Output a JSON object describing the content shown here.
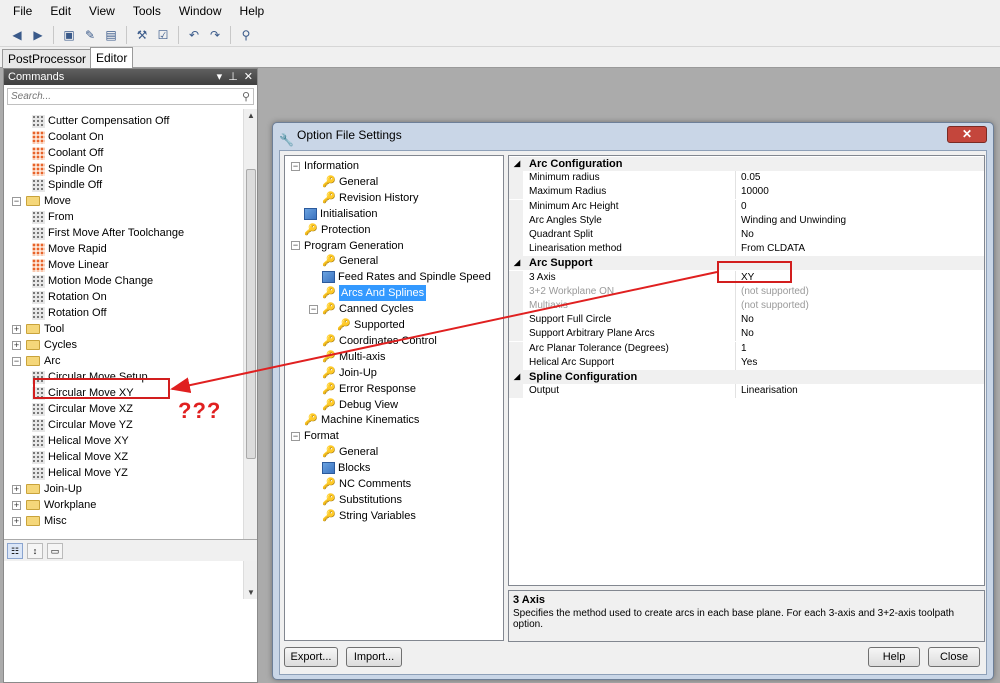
{
  "menu": [
    "File",
    "Edit",
    "View",
    "Tools",
    "Window",
    "Help"
  ],
  "tabs": [
    "PostProcessor",
    "Editor"
  ],
  "commands_panel": {
    "title": "Commands",
    "search_placeholder": "Search...",
    "items": [
      {
        "label": "Cutter Compensation Off",
        "level": 2,
        "icon": "grid"
      },
      {
        "label": "Coolant On",
        "level": 2,
        "icon": "grid-orange"
      },
      {
        "label": "Coolant Off",
        "level": 2,
        "icon": "grid-orange"
      },
      {
        "label": "Spindle On",
        "level": 2,
        "icon": "grid-orange"
      },
      {
        "label": "Spindle Off",
        "level": 2,
        "icon": "grid"
      },
      {
        "label": "Move",
        "level": 1,
        "icon": "folder",
        "expander": "−"
      },
      {
        "label": "From",
        "level": 2,
        "icon": "grid"
      },
      {
        "label": "First Move After Toolchange",
        "level": 2,
        "icon": "grid"
      },
      {
        "label": "Move Rapid",
        "level": 2,
        "icon": "grid-orange"
      },
      {
        "label": "Move Linear",
        "level": 2,
        "icon": "grid-orange"
      },
      {
        "label": "Motion Mode Change",
        "level": 2,
        "icon": "grid"
      },
      {
        "label": "Rotation On",
        "level": 2,
        "icon": "grid"
      },
      {
        "label": "Rotation Off",
        "level": 2,
        "icon": "grid"
      },
      {
        "label": "Tool",
        "level": 1,
        "icon": "folder",
        "expander": "+"
      },
      {
        "label": "Cycles",
        "level": 1,
        "icon": "folder",
        "expander": "+"
      },
      {
        "label": "Arc",
        "level": 1,
        "icon": "folder",
        "expander": "−"
      },
      {
        "label": "Circular Move Setup",
        "level": 2,
        "icon": "grid"
      },
      {
        "label": "Circular Move XY",
        "level": 2,
        "icon": "grid"
      },
      {
        "label": "Circular Move XZ",
        "level": 2,
        "icon": "grid"
      },
      {
        "label": "Circular Move YZ",
        "level": 2,
        "icon": "grid"
      },
      {
        "label": "Helical Move XY",
        "level": 2,
        "icon": "grid"
      },
      {
        "label": "Helical Move XZ",
        "level": 2,
        "icon": "grid"
      },
      {
        "label": "Helical Move YZ",
        "level": 2,
        "icon": "grid"
      },
      {
        "label": "Join-Up",
        "level": 1,
        "icon": "folder",
        "expander": "+"
      },
      {
        "label": "Workplane",
        "level": 1,
        "icon": "folder",
        "expander": "+"
      },
      {
        "label": "Misc",
        "level": 1,
        "icon": "folder",
        "expander": "+"
      }
    ]
  },
  "dialog": {
    "title": "Option File Settings",
    "tree": [
      {
        "label": "Information",
        "level": 0,
        "expander": "−"
      },
      {
        "label": "General",
        "level": 1,
        "icon": "key"
      },
      {
        "label": "Revision History",
        "level": 1,
        "icon": "key"
      },
      {
        "label": "Initialisation",
        "level": 0,
        "icon": "img"
      },
      {
        "label": "Protection",
        "level": 0,
        "icon": "key"
      },
      {
        "label": "Program Generation",
        "level": 0,
        "expander": "−"
      },
      {
        "label": "General",
        "level": 1,
        "icon": "key"
      },
      {
        "label": "Feed Rates and Spindle Speed",
        "level": 1,
        "icon": "img"
      },
      {
        "label": "Arcs And Splines",
        "level": 1,
        "icon": "key",
        "selected": true
      },
      {
        "label": "Canned Cycles",
        "level": 1,
        "icon": "key",
        "expander": "−"
      },
      {
        "label": "Supported",
        "level": 2,
        "icon": "key"
      },
      {
        "label": "Coordinates Control",
        "level": 1,
        "icon": "key"
      },
      {
        "label": "Multi-axis",
        "level": 1,
        "icon": "key"
      },
      {
        "label": "Join-Up",
        "level": 1,
        "icon": "key"
      },
      {
        "label": "Error Response",
        "level": 1,
        "icon": "key"
      },
      {
        "label": "Debug View",
        "level": 1,
        "icon": "key"
      },
      {
        "label": "Machine Kinematics",
        "level": 0,
        "icon": "key"
      },
      {
        "label": "Format",
        "level": 0,
        "expander": "−"
      },
      {
        "label": "General",
        "level": 1,
        "icon": "key"
      },
      {
        "label": "Blocks",
        "level": 1,
        "icon": "img"
      },
      {
        "label": "NC Comments",
        "level": 1,
        "icon": "key"
      },
      {
        "label": "Substitutions",
        "level": 1,
        "icon": "key"
      },
      {
        "label": "String Variables",
        "level": 1,
        "icon": "key"
      }
    ],
    "properties": [
      {
        "category": "Arc Configuration",
        "rows": [
          {
            "name": "Minimum radius",
            "value": "0.05"
          },
          {
            "name": "Maximum Radius",
            "value": "10000"
          },
          {
            "name": "Minimum Arc Height",
            "value": "0"
          },
          {
            "name": "Arc Angles Style",
            "value": "Winding and Unwinding"
          },
          {
            "name": "Quadrant Split",
            "value": "No"
          },
          {
            "name": "Linearisation method",
            "value": "From CLDATA"
          }
        ]
      },
      {
        "category": "Arc Support",
        "rows": [
          {
            "name": "3 Axis",
            "value": "XY"
          },
          {
            "name": "3+2 Workplane ON",
            "value": "(not supported)",
            "disabled": true
          },
          {
            "name": "Multiaxis",
            "value": "(not supported)",
            "disabled": true
          },
          {
            "name": "Support Full Circle",
            "value": "No"
          },
          {
            "name": "Support Arbitrary Plane Arcs",
            "value": "No"
          },
          {
            "name": "Arc Planar Tolerance (Degrees)",
            "value": "1"
          },
          {
            "name": "Helical Arc Support",
            "value": "Yes"
          }
        ]
      },
      {
        "category": "Spline Configuration",
        "rows": [
          {
            "name": "Output",
            "value": "Linearisation"
          }
        ]
      }
    ],
    "description": {
      "title": "3 Axis",
      "text": "Specifies the method used to create arcs in each base plane. For each 3-axis and 3+2-axis toolpath option."
    },
    "buttons": {
      "export": "Export...",
      "import": "Import...",
      "help": "Help",
      "close": "Close"
    }
  },
  "annotation": {
    "question_marks": "???",
    "color": "#e02020"
  }
}
